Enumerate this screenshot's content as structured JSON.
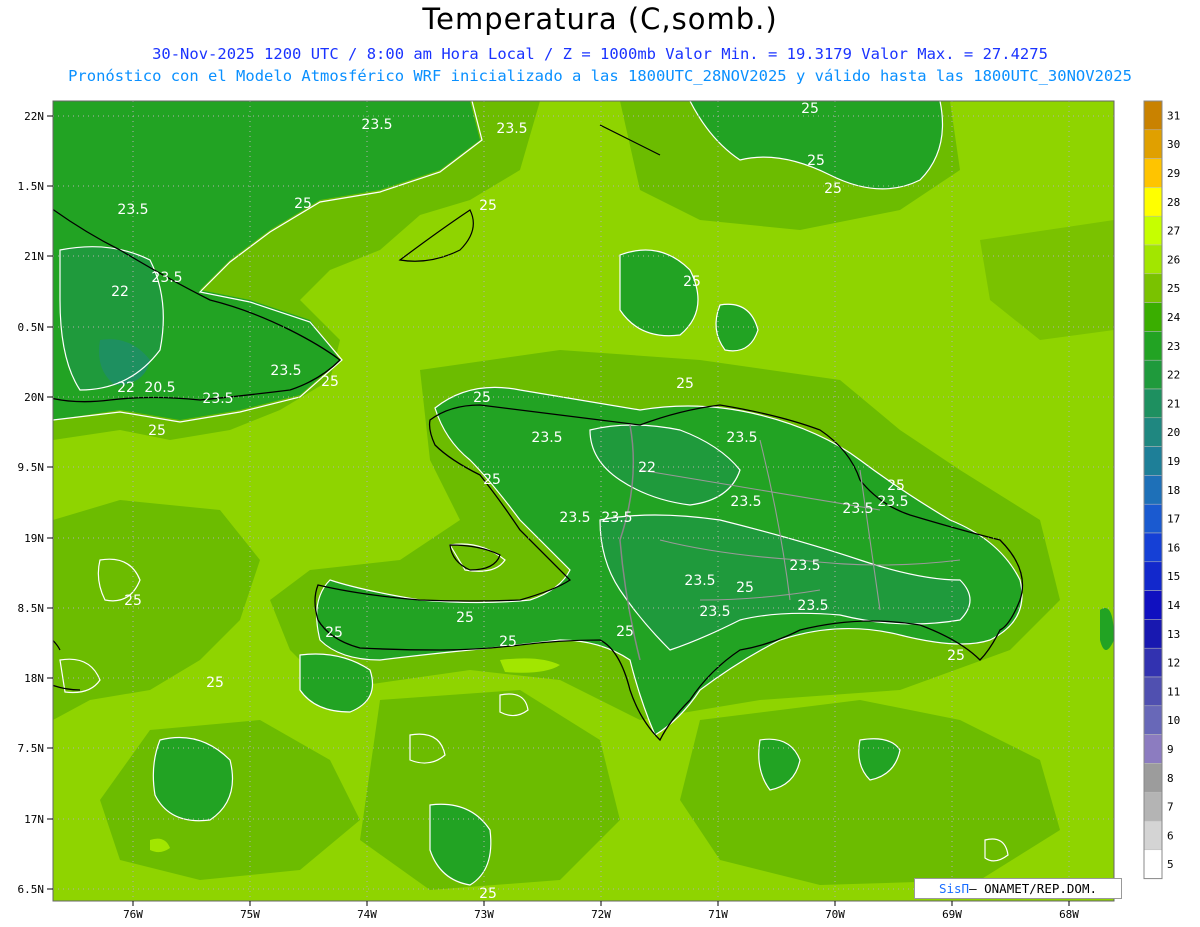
{
  "header": {
    "title": "Temperatura (C,somb.)",
    "line1": "30-Nov-2025  1200 UTC / 8:00 am Hora Local / Z = 1000mb   Valor Min. = 19.3179  Valor Max. = 27.4275",
    "line2": "Pronóstico con el Modelo Atmosférico WRF inicializado a las 1800UTC_28NOV2025 y válido hasta las  1800UTC_30NOV2025"
  },
  "axes": {
    "lat_labels": [
      "22N",
      "1.5N",
      "21N",
      "0.5N",
      "20N",
      "9.5N",
      "19N",
      "8.5N",
      "18N",
      "7.5N",
      "17N",
      "6.5N"
    ],
    "lon_labels": [
      "76W",
      "75W",
      "74W",
      "73W",
      "72W",
      "71W",
      "70W",
      "69W",
      "68W"
    ]
  },
  "colorbar": {
    "labels": [
      "31",
      "30",
      "29",
      "28",
      "27",
      "26",
      "25",
      "24",
      "23",
      "22",
      "21",
      "20",
      "19",
      "18",
      "17",
      "16",
      "15",
      "14",
      "13",
      "12",
      "11",
      "10",
      "9",
      "8",
      "7",
      "6",
      "5"
    ],
    "colors": [
      "#c98200",
      "#e0a000",
      "#ffc400",
      "#ffff00",
      "#c6ff00",
      "#a2e600",
      "#7ac200",
      "#3aae00",
      "#22a323",
      "#1f9a3c",
      "#1e9060",
      "#1f8780",
      "#1e7f98",
      "#1e70b8",
      "#1a5ad0",
      "#1540d6",
      "#1228cc",
      "#1010c0",
      "#1818b0",
      "#3232b0",
      "#5050b0",
      "#6868b8",
      "#8c7cc0",
      "#9c9c9c",
      "#b4b4b4",
      "#d4d4d4",
      "#ffffff"
    ]
  },
  "contour_labels": [
    "23.5",
    "23.5",
    "25",
    "25",
    "25",
    "23.5",
    "25",
    "25",
    "23.5",
    "22",
    "22",
    "20.5",
    "23.5",
    "25",
    "23.5",
    "25",
    "25",
    "23.5",
    "23.5",
    "22",
    "25",
    "23.5",
    "23.5",
    "23.5",
    "25",
    "23.5",
    "23.5",
    "25",
    "23.5",
    "25",
    "25",
    "25",
    "23.5",
    "25",
    "25",
    "23.5",
    "23.5",
    "25",
    "25",
    "25",
    "25",
    "25"
  ],
  "credit": {
    "brand": "SisΠ",
    "text": "– ONAMET/REP.DOM."
  }
}
